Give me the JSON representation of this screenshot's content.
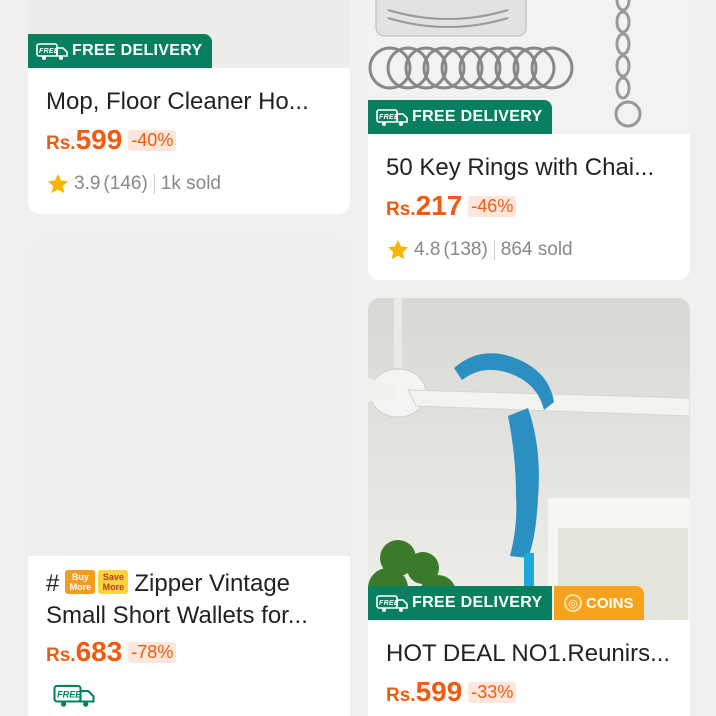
{
  "colors": {
    "badge_green": "#08805f",
    "price_orange": "#f25a0f",
    "coins_orange": "#f7a21b"
  },
  "products": [
    {
      "badge": "FREE DELIVERY",
      "title": "Mop, Floor Cleaner Ho...",
      "currency": "Rs.",
      "price": "599",
      "discount": "-40%",
      "rating": "3.9",
      "reviews": "(146)",
      "sold": "1k sold"
    },
    {
      "badge": "FREE DELIVERY",
      "title": "50 Key Rings with Chai...",
      "currency": "Rs.",
      "price": "217",
      "discount": "-46%",
      "rating": "4.8",
      "reviews": "(138)",
      "sold": "864 sold"
    },
    {
      "title_prefix": "#",
      "tag_buy_more": [
        "Buy",
        "More"
      ],
      "tag_save_more": [
        "Save",
        "More"
      ],
      "title": "Zipper Vintage Small Short Wallets for...",
      "currency": "Rs.",
      "price": "683",
      "discount": "-78%",
      "free_icon": "free-delivery-truck-icon"
    },
    {
      "badge": "FREE DELIVERY",
      "coins": "COINS",
      "title": "HOT DEAL NO1.Reunirs...",
      "currency": "Rs.",
      "price": "599",
      "discount": "-33%"
    }
  ]
}
